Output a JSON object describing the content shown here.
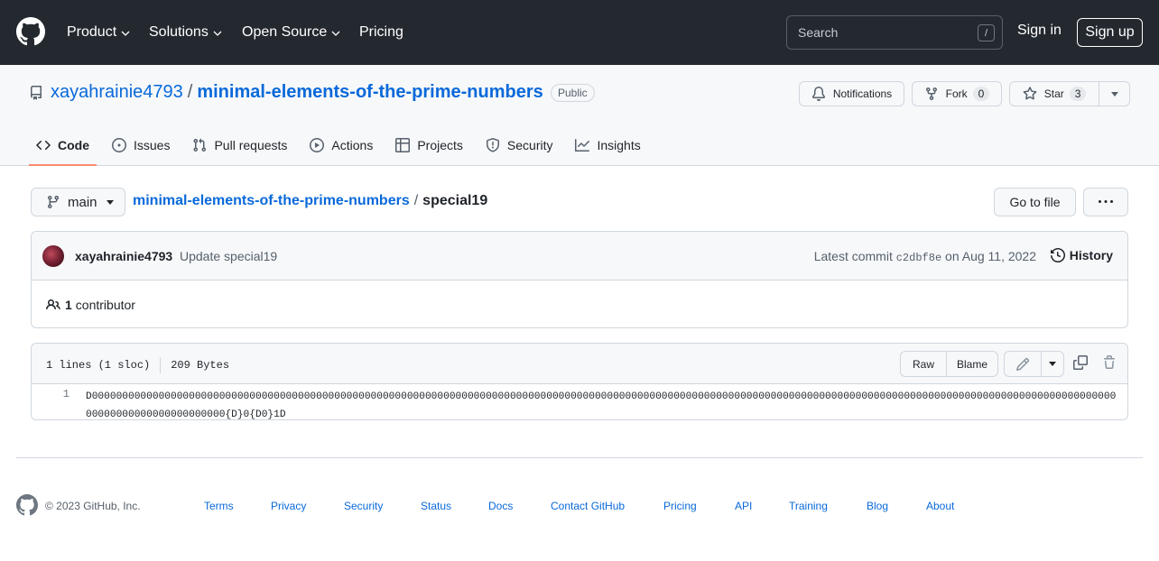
{
  "header": {
    "nav": [
      {
        "label": "Product",
        "has_menu": true
      },
      {
        "label": "Solutions",
        "has_menu": true
      },
      {
        "label": "Open Source",
        "has_menu": true
      },
      {
        "label": "Pricing",
        "has_menu": false
      }
    ],
    "search": {
      "placeholder": "Search",
      "shortcut": "/"
    },
    "sign_in": "Sign in",
    "sign_up": "Sign up"
  },
  "repo": {
    "owner": "xayahrainie4793",
    "separator": "/",
    "name": "minimal-elements-of-the-prime-numbers",
    "visibility": "Public",
    "notifications_label": "Notifications",
    "fork_label": "Fork",
    "fork_count": "0",
    "star_label": "Star",
    "star_count": "3"
  },
  "tabs": [
    {
      "label": "Code",
      "icon": "code-icon",
      "selected": true
    },
    {
      "label": "Issues",
      "icon": "issue-opened-icon",
      "selected": false
    },
    {
      "label": "Pull requests",
      "icon": "git-pull-request-icon",
      "selected": false
    },
    {
      "label": "Actions",
      "icon": "play-icon",
      "selected": false
    },
    {
      "label": "Projects",
      "icon": "table-icon",
      "selected": false
    },
    {
      "label": "Security",
      "icon": "shield-icon",
      "selected": false
    },
    {
      "label": "Insights",
      "icon": "graph-icon",
      "selected": false
    }
  ],
  "file_nav": {
    "branch": "main",
    "repo_link": "minimal-elements-of-the-prime-numbers",
    "separator": "/",
    "file_name": "special19",
    "go_to_file": "Go to file"
  },
  "commit": {
    "author": "xayahrainie4793",
    "message": "Update special19",
    "latest_prefix": "Latest commit",
    "sha": "c2dbf8e",
    "date": "on Aug 11, 2022",
    "history_label": "History",
    "contributors_count": "1",
    "contributors_label": "contributor"
  },
  "file": {
    "lines_info": "1 lines (1 sloc)",
    "size": "209 Bytes",
    "raw_label": "Raw",
    "blame_label": "Blame",
    "lines": [
      {
        "number": "1",
        "code": "D000000000000000000000000000000000000000000000000000000000000000000000000000000000000000000000000000000000000000000000000000000000000000000000000000000000000000000000000000000000000000000000000{D}0{D0}1D"
      }
    ]
  },
  "footer": {
    "copyright": "© 2023 GitHub, Inc.",
    "links": [
      "Terms",
      "Privacy",
      "Security",
      "Status",
      "Docs",
      "Contact GitHub",
      "Pricing",
      "API",
      "Training",
      "Blog",
      "About"
    ]
  },
  "colors": {
    "header_bg": "#24292f",
    "link": "#0969da",
    "tab_underline": "#fd8c73",
    "border": "#d0d7de",
    "muted_text": "#57606a"
  }
}
